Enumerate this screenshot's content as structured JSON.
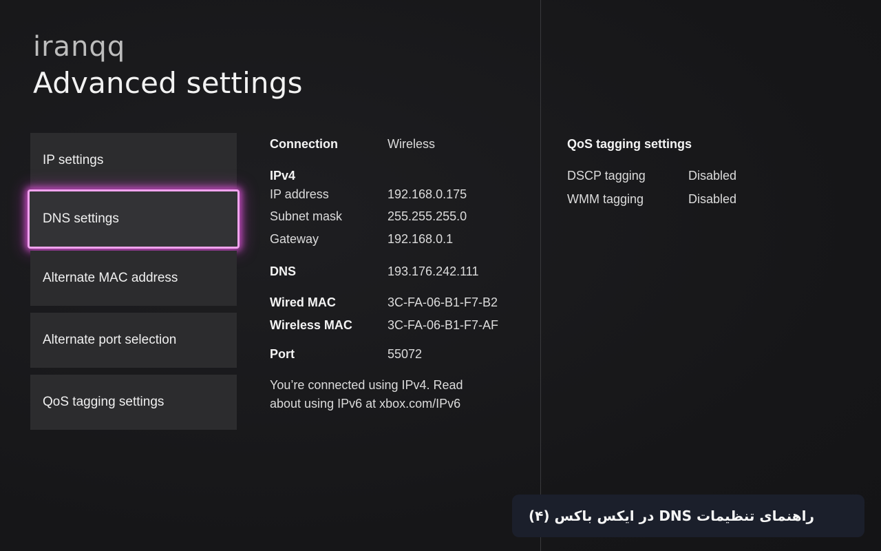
{
  "brand": {
    "logo_text": "iranqq"
  },
  "header": {
    "title": "Advanced settings"
  },
  "menu": {
    "items": [
      {
        "label": "IP settings"
      },
      {
        "label": "DNS settings",
        "focused": true
      },
      {
        "label": "Alternate MAC address"
      },
      {
        "label": "Alternate port selection"
      },
      {
        "label": "QoS tagging settings"
      }
    ]
  },
  "details": {
    "connection": {
      "label": "Connection",
      "value": "Wireless"
    },
    "ipv4_heading": "IPv4",
    "ip_address": {
      "label": "IP address",
      "value": "192.168.0.175"
    },
    "subnet_mask": {
      "label": "Subnet mask",
      "value": "255.255.255.0"
    },
    "gateway": {
      "label": "Gateway",
      "value": "192.168.0.1"
    },
    "dns": {
      "label": "DNS",
      "value": "193.176.242.111"
    },
    "wired_mac": {
      "label": "Wired MAC",
      "value": "3C-FA-06-B1-F7-B2"
    },
    "wireless_mac": {
      "label": "Wireless MAC",
      "value": "3C-FA-06-B1-F7-AF"
    },
    "port": {
      "label": "Port",
      "value": "55072"
    },
    "note_line1": "You’re connected using IPv4. Read",
    "note_line2": "about using IPv6 at xbox.com/IPv6"
  },
  "qos": {
    "title": "QoS tagging settings",
    "dscp": {
      "label": "DSCP tagging",
      "value": "Disabled"
    },
    "wmm": {
      "label": "WMM tagging",
      "value": "Disabled"
    }
  },
  "caption": {
    "text": "راهنمای تنظیمات DNS در ایکس باکس (۴)"
  },
  "colors": {
    "background": "#18181a",
    "tile": "#2c2c2e",
    "focus_glow": "#e85ae6",
    "caption_bg": "#1b1f2b"
  }
}
